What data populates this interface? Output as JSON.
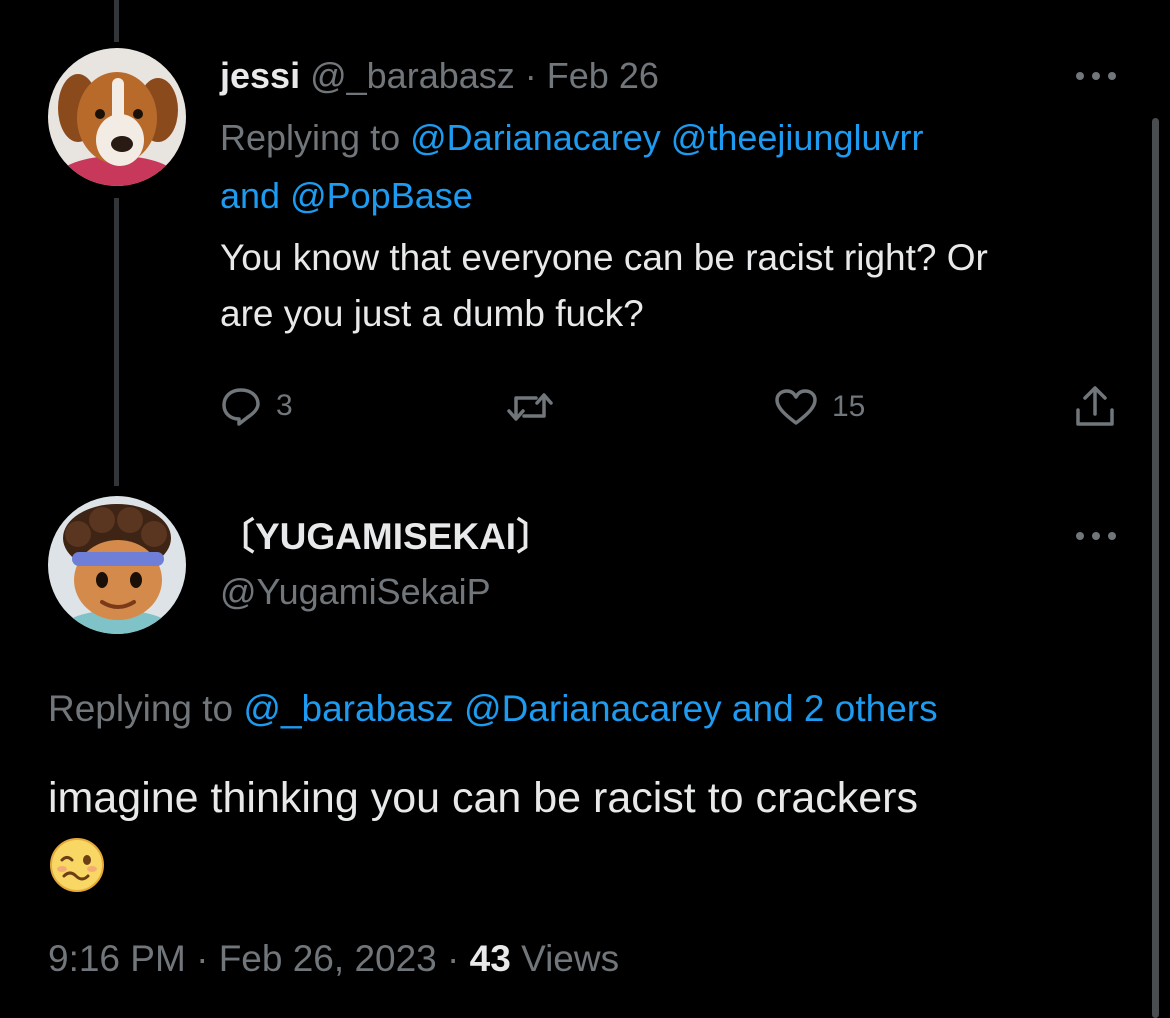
{
  "parent_tweet": {
    "display_name": "jessi",
    "handle": "@_barabasz",
    "separator": "·",
    "date": "Feb 26",
    "replying_prefix": "Replying to",
    "replying_to_1": "@Darianacarey",
    "replying_to_2": "@theejiungluvrr",
    "replying_conj": "and",
    "replying_to_3": "@PopBase",
    "text_line_1": "You know that everyone can be racist right? Or",
    "text_line_2": "are you just a dumb fuck?",
    "reply_count": "3",
    "like_count": "15",
    "avatar_icon": "dog-avatar"
  },
  "main_tweet": {
    "display_name": "〔YUGAMISEKAI〕",
    "handle": "@YugamiSekaiP",
    "replying_prefix": "Replying to",
    "replying_to_1": "@_barabasz",
    "replying_to_2": "@Darianacarey",
    "replying_others": "and 2 others",
    "text_line_1": "imagine thinking you can be racist to crackers",
    "emoji": "woozy-face-emoji",
    "time": "9:16 PM",
    "separator_1": "·",
    "date": "Feb 26, 2023",
    "separator_2": "·",
    "views_count": "43",
    "views_label": "Views",
    "avatar_icon": "cartoon-boy-avatar"
  },
  "colors": {
    "background": "#000000",
    "text": "#e7e9ea",
    "muted": "#71767b",
    "link": "#1d9bf0",
    "thread_line": "#333639"
  }
}
